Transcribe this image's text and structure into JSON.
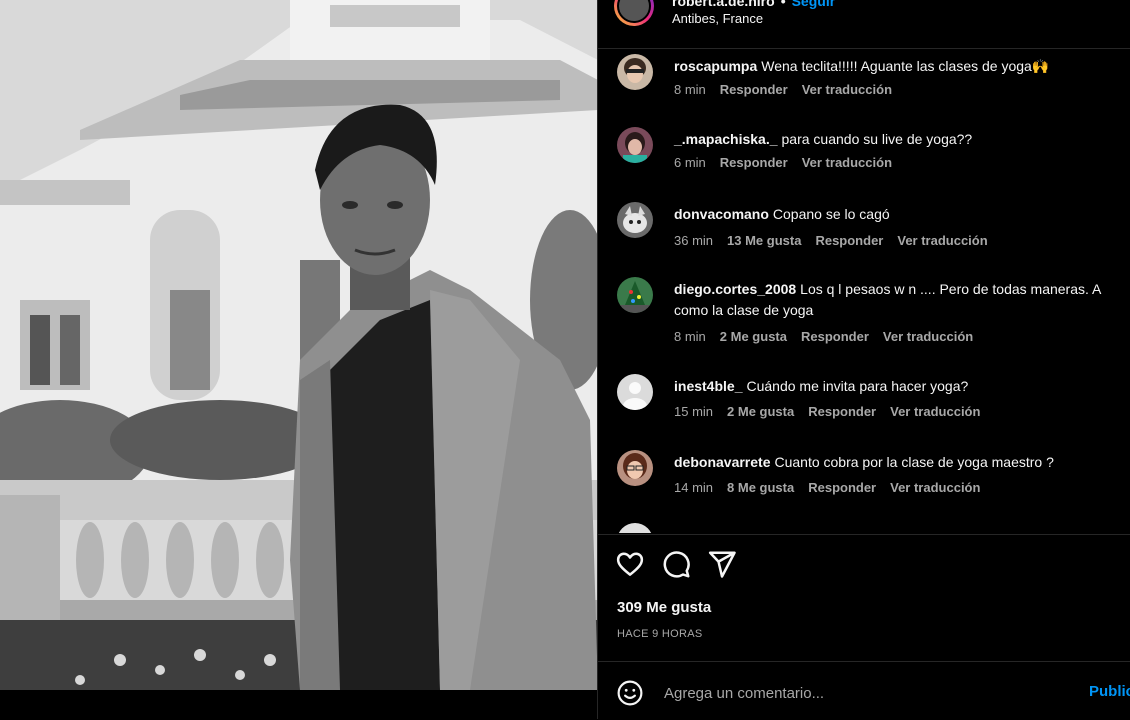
{
  "post": {
    "username": "robert.a.de.niro",
    "separator": "•",
    "follow_label": "Seguir",
    "location": "Antibes, France",
    "likes": "309 Me gusta",
    "time_ago": "HACE 9 HORAS",
    "comment_placeholder": "Agrega un comentario...",
    "publish_label": "Publicar"
  },
  "comments": [
    {
      "user": "roscapumpa",
      "text": "Wena teclita!!!!! Aguante las clases de yoga🙌",
      "time": "8 min",
      "likes": "",
      "reply": "Responder",
      "translate": "Ver traducción"
    },
    {
      "user": "_.mapachiska._",
      "text": "para cuando su live de yoga??",
      "time": "6 min",
      "likes": "",
      "reply": "Responder",
      "translate": "Ver traducción"
    },
    {
      "user": "donvacomano",
      "text": "Copano se lo cagó",
      "time": "36 min",
      "likes": "13 Me gusta",
      "reply": "Responder",
      "translate": "Ver traducción"
    },
    {
      "user": "diego.cortes_2008",
      "text": "Los q l pesaos w n .... Pero de todas maneras. A como la clase de yoga",
      "time": "8 min",
      "likes": "2 Me gusta",
      "reply": "Responder",
      "translate": "Ver traducción"
    },
    {
      "user": "inest4ble_",
      "text": "Cuándo me invita para hacer yoga?",
      "time": "15 min",
      "likes": "2 Me gusta",
      "reply": "Responder",
      "translate": "Ver traducción"
    },
    {
      "user": "debonavarrete",
      "text": "Cuanto cobra por la clase de yoga maestro ?",
      "time": "14 min",
      "likes": "8 Me gusta",
      "reply": "Responder",
      "translate": "Ver traducción"
    }
  ],
  "icons": {
    "like": "heart-icon",
    "comment": "comment-bubble-icon",
    "share": "paper-plane-icon",
    "emoji": "emoji-smile-icon"
  },
  "colors": {
    "background": "#000000",
    "link_blue": "#0095f6",
    "muted_text": "#a8a8a8",
    "divider": "#262626"
  }
}
